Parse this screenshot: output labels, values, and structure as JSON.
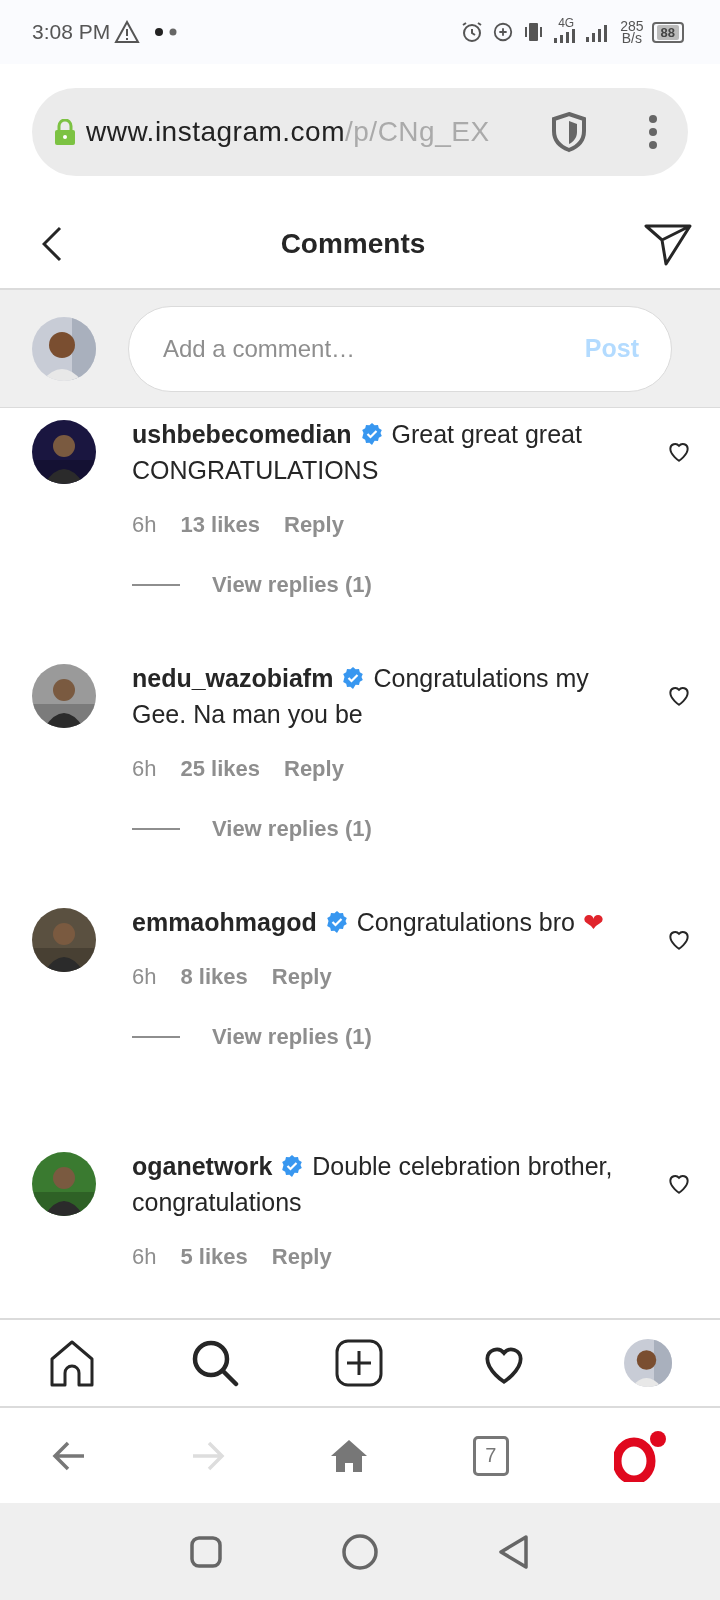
{
  "status_bar": {
    "time": "3:08 PM",
    "network_type": "4G",
    "speed": "285",
    "speed_unit": "B/s",
    "battery": "88"
  },
  "browser": {
    "url_host": "www.instagram.com",
    "url_path": "/p/CNg_EX"
  },
  "header": {
    "title": "Comments"
  },
  "composer": {
    "placeholder": "Add a comment…",
    "post_label": "Post",
    "post_enabled": false
  },
  "comments": [
    {
      "username": "ushbebecomedian",
      "verified": true,
      "text": "Great great great CONGRATULATIONS",
      "time": "6h",
      "likes": "13 likes",
      "reply": "Reply",
      "view_replies": "View replies (1)"
    },
    {
      "username": "nedu_wazobiafm",
      "verified": true,
      "text": "Congratulations my Gee. Na man you be",
      "time": "6h",
      "likes": "25 likes",
      "reply": "Reply",
      "view_replies": "View replies (1)"
    },
    {
      "username": "emmaohmagod",
      "verified": true,
      "text": "Congratulations bro",
      "emoji": "❤",
      "time": "6h",
      "likes": "8 likes",
      "reply": "Reply",
      "view_replies": "View replies (1)"
    },
    {
      "username": "oganetwork",
      "verified": true,
      "text": "Double celebration brother, congratulations",
      "time": "6h",
      "likes": "5 likes",
      "reply": "Reply"
    }
  ],
  "browser_nav": {
    "tab_count": "7",
    "forward_enabled": false
  }
}
